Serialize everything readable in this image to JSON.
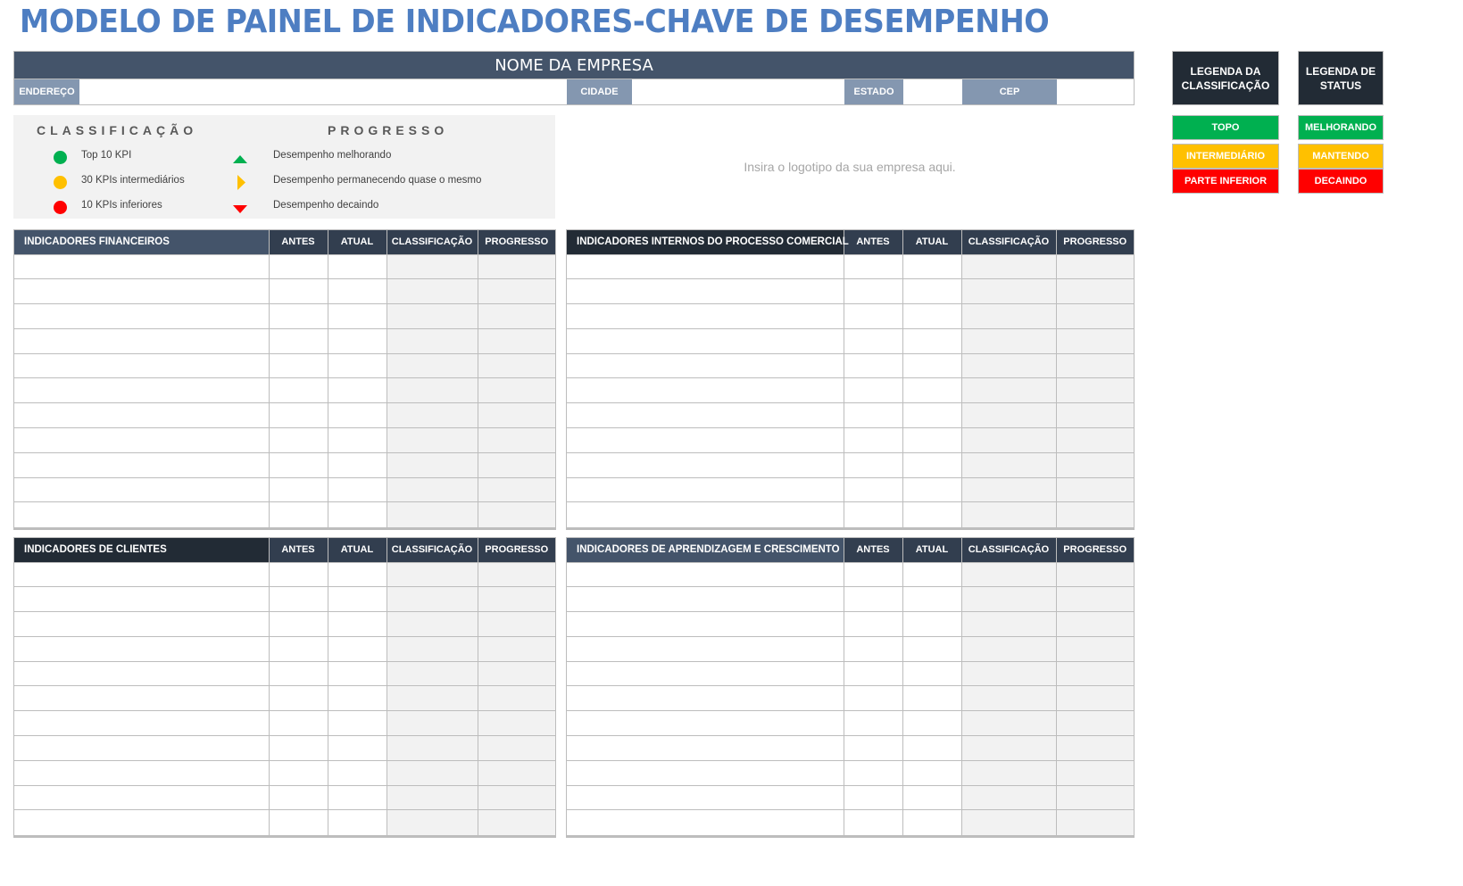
{
  "title": "MODELO DE PAINEL DE INDICADORES-CHAVE DE DESEMPENHO",
  "company": {
    "name": "NOME DA EMPRESA",
    "address_label": "ENDEREÇO",
    "address_value": "",
    "city_label": "CIDADE",
    "city_value": "",
    "state_label": "ESTADO",
    "state_value": "",
    "zip_label": "CEP",
    "zip_value": ""
  },
  "legend": {
    "classification_heading": "CLASSIFICAÇÃO",
    "progress_heading": "PROGRESSO",
    "classification_items": [
      {
        "label": "Top 10 KPI",
        "color": "#00B050"
      },
      {
        "label": "30 KPIs intermediários",
        "color": "#FFC000"
      },
      {
        "label": "10 KPIs inferiores",
        "color": "#FF0000"
      }
    ],
    "progress_items": [
      {
        "label": "Desempenho melhorando",
        "icon": "triangle-up-icon",
        "color": "#00B050"
      },
      {
        "label": "Desempenho permanecendo quase o mesmo",
        "icon": "triangle-right-icon",
        "color": "#FFC000"
      },
      {
        "label": "Desempenho decaindo",
        "icon": "triangle-down-icon",
        "color": "#FF0000"
      }
    ]
  },
  "logo_placeholder": "Insira o logotipo da sua empresa aqui.",
  "rank_legend": {
    "title": "LEGENDA DA CLASSIFICAÇÃO",
    "items": [
      {
        "label": "TOPO",
        "color": "#00B050"
      },
      {
        "label": "INTERMEDIÁRIO",
        "color": "#FFC000"
      },
      {
        "label": "PARTE INFERIOR",
        "color": "#FF0000"
      }
    ]
  },
  "status_legend": {
    "title": "LEGENDA DE STATUS",
    "items": [
      {
        "label": "MELHORANDO",
        "color": "#00B050"
      },
      {
        "label": "MANTENDO",
        "color": "#FFC000"
      },
      {
        "label": "DECAINDO",
        "color": "#FF0000"
      }
    ]
  },
  "columns": {
    "before": "ANTES",
    "current": "ATUAL",
    "classification": "CLASSIFICAÇÃO",
    "progress": "PROGRESSO"
  },
  "tables": [
    {
      "title": "INDICADORES FINANCEIROS",
      "rows": 11
    },
    {
      "title": "INDICADORES INTERNOS DO PROCESSO COMERCIAL",
      "rows": 11
    },
    {
      "title": "INDICADORES DE CLIENTES",
      "rows": 11
    },
    {
      "title": "INDICADORES DE APRENDIZAGEM E CRESCIMENTO",
      "rows": 11
    }
  ]
}
